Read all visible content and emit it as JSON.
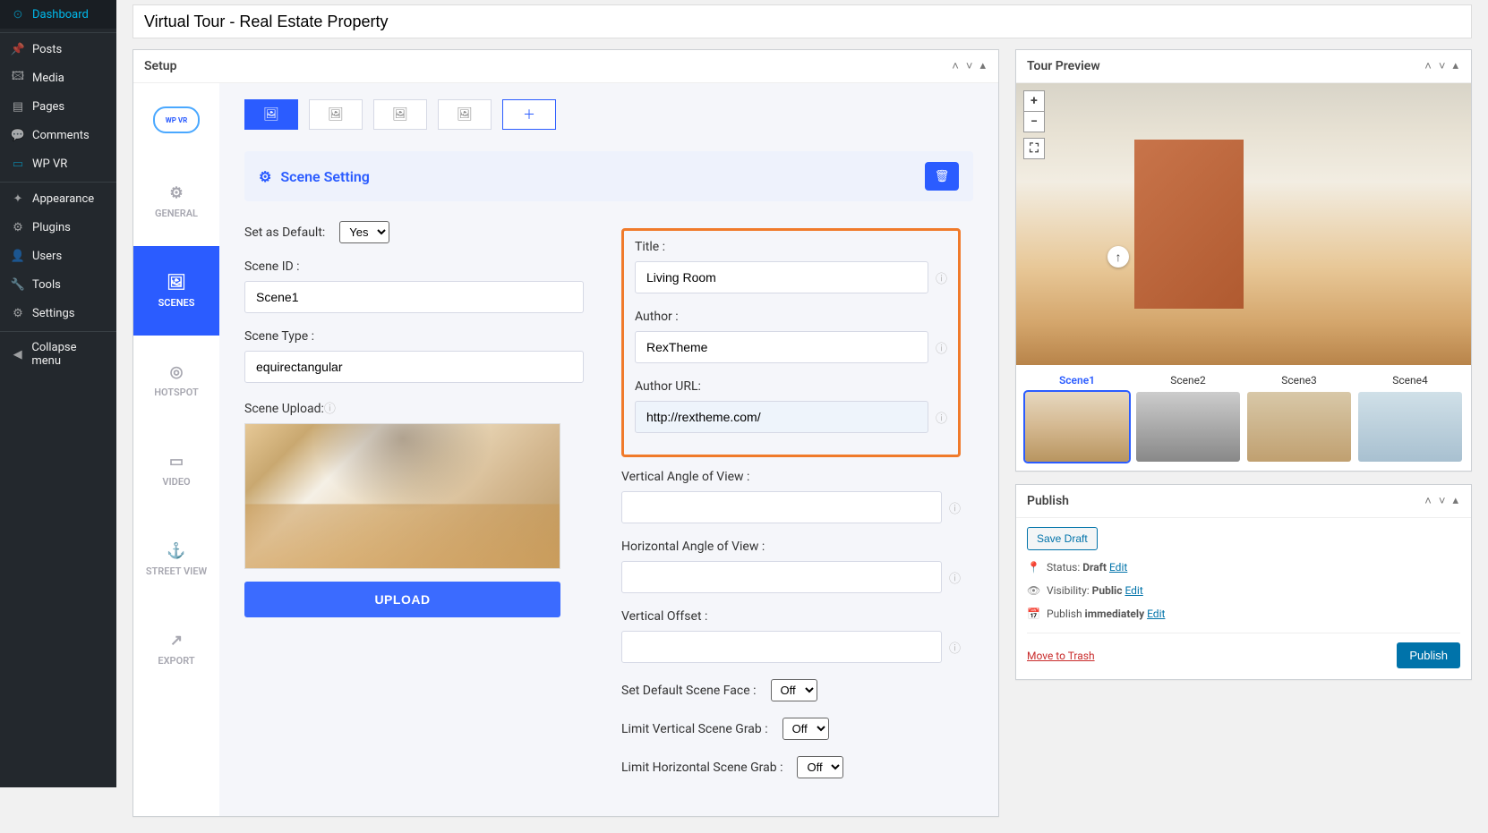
{
  "sidebar": {
    "items": [
      {
        "icon": "⊙",
        "label": "Dashboard"
      },
      {
        "icon": "✎",
        "label": "Posts"
      },
      {
        "icon": "🖾",
        "label": "Media"
      },
      {
        "icon": "▤",
        "label": "Pages"
      },
      {
        "icon": "💬",
        "label": "Comments"
      },
      {
        "icon": "▭",
        "label": "WP VR"
      },
      {
        "icon": "✦",
        "label": "Appearance"
      },
      {
        "icon": "⚙",
        "label": "Plugins"
      },
      {
        "icon": "👤",
        "label": "Users"
      },
      {
        "icon": "🔧",
        "label": "Tools"
      },
      {
        "icon": "⚙",
        "label": "Settings"
      },
      {
        "icon": "◀",
        "label": "Collapse menu"
      }
    ]
  },
  "page_title": "Virtual Tour - Real Estate Property",
  "setup": {
    "header": "Setup",
    "tabs": [
      {
        "label": "GENERAL",
        "icon": "⚙"
      },
      {
        "label": "SCENES",
        "icon": "🖼"
      },
      {
        "label": "HOTSPOT",
        "icon": "◎"
      },
      {
        "label": "VIDEO",
        "icon": "▭"
      },
      {
        "label": "STREET VIEW",
        "icon": "⚓"
      },
      {
        "label": "EXPORT",
        "icon": "↗"
      }
    ],
    "scene_heading": "Scene Setting",
    "labels": {
      "set_default": "Set as Default:",
      "scene_id": "Scene ID :",
      "scene_type": "Scene Type :",
      "scene_upload": "Scene Upload:",
      "title": "Title :",
      "author": "Author :",
      "author_url": "Author URL:",
      "vaov": "Vertical Angle of View :",
      "haov": "Horizontal Angle of View :",
      "voffset": "Vertical Offset :",
      "default_face": "Set Default Scene Face :",
      "limit_v": "Limit Vertical Scene Grab :",
      "limit_h": "Limit Horizontal Scene Grab :"
    },
    "values": {
      "set_default": "Yes",
      "scene_id": "Scene1",
      "scene_type": "equirectangular",
      "title": "Living Room",
      "author": "RexTheme",
      "author_url": "http://rextheme.com/",
      "vaov": "",
      "haov": "",
      "voffset": "",
      "default_face": "Off",
      "limit_v": "Off",
      "limit_h": "Off"
    },
    "upload_btn": "UPLOAD"
  },
  "preview": {
    "header": "Tour Preview",
    "scenes": [
      "Scene1",
      "Scene2",
      "Scene3",
      "Scene4"
    ]
  },
  "publish": {
    "header": "Publish",
    "save_draft": "Save Draft",
    "status_label": "Status:",
    "status_value": "Draft",
    "visibility_label": "Visibility:",
    "visibility_value": "Public",
    "schedule_label": "Publish",
    "schedule_value": "immediately",
    "edit": "Edit",
    "trash": "Move to Trash",
    "publish_btn": "Publish"
  }
}
